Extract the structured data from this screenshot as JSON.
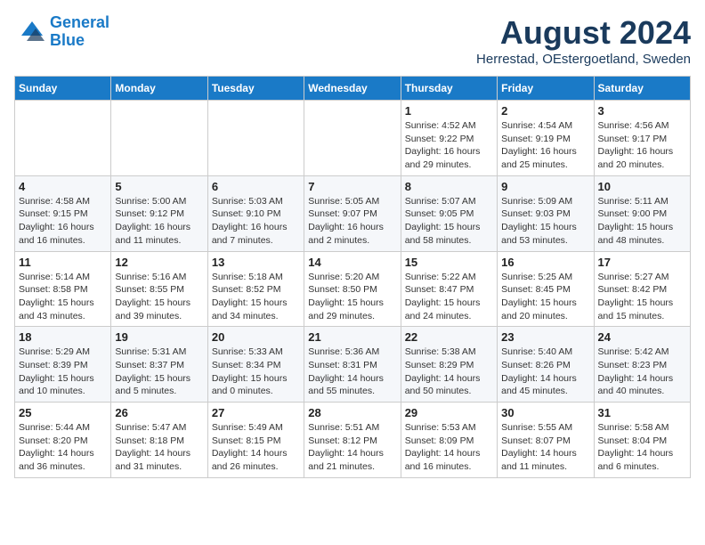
{
  "logo": {
    "line1": "General",
    "line2": "Blue"
  },
  "title": "August 2024",
  "location": "Herrestad, OEstergoetland, Sweden",
  "weekdays": [
    "Sunday",
    "Monday",
    "Tuesday",
    "Wednesday",
    "Thursday",
    "Friday",
    "Saturday"
  ],
  "weeks": [
    [
      {
        "day": "",
        "info": ""
      },
      {
        "day": "",
        "info": ""
      },
      {
        "day": "",
        "info": ""
      },
      {
        "day": "",
        "info": ""
      },
      {
        "day": "1",
        "info": "Sunrise: 4:52 AM\nSunset: 9:22 PM\nDaylight: 16 hours\nand 29 minutes."
      },
      {
        "day": "2",
        "info": "Sunrise: 4:54 AM\nSunset: 9:19 PM\nDaylight: 16 hours\nand 25 minutes."
      },
      {
        "day": "3",
        "info": "Sunrise: 4:56 AM\nSunset: 9:17 PM\nDaylight: 16 hours\nand 20 minutes."
      }
    ],
    [
      {
        "day": "4",
        "info": "Sunrise: 4:58 AM\nSunset: 9:15 PM\nDaylight: 16 hours\nand 16 minutes."
      },
      {
        "day": "5",
        "info": "Sunrise: 5:00 AM\nSunset: 9:12 PM\nDaylight: 16 hours\nand 11 minutes."
      },
      {
        "day": "6",
        "info": "Sunrise: 5:03 AM\nSunset: 9:10 PM\nDaylight: 16 hours\nand 7 minutes."
      },
      {
        "day": "7",
        "info": "Sunrise: 5:05 AM\nSunset: 9:07 PM\nDaylight: 16 hours\nand 2 minutes."
      },
      {
        "day": "8",
        "info": "Sunrise: 5:07 AM\nSunset: 9:05 PM\nDaylight: 15 hours\nand 58 minutes."
      },
      {
        "day": "9",
        "info": "Sunrise: 5:09 AM\nSunset: 9:03 PM\nDaylight: 15 hours\nand 53 minutes."
      },
      {
        "day": "10",
        "info": "Sunrise: 5:11 AM\nSunset: 9:00 PM\nDaylight: 15 hours\nand 48 minutes."
      }
    ],
    [
      {
        "day": "11",
        "info": "Sunrise: 5:14 AM\nSunset: 8:58 PM\nDaylight: 15 hours\nand 43 minutes."
      },
      {
        "day": "12",
        "info": "Sunrise: 5:16 AM\nSunset: 8:55 PM\nDaylight: 15 hours\nand 39 minutes."
      },
      {
        "day": "13",
        "info": "Sunrise: 5:18 AM\nSunset: 8:52 PM\nDaylight: 15 hours\nand 34 minutes."
      },
      {
        "day": "14",
        "info": "Sunrise: 5:20 AM\nSunset: 8:50 PM\nDaylight: 15 hours\nand 29 minutes."
      },
      {
        "day": "15",
        "info": "Sunrise: 5:22 AM\nSunset: 8:47 PM\nDaylight: 15 hours\nand 24 minutes."
      },
      {
        "day": "16",
        "info": "Sunrise: 5:25 AM\nSunset: 8:45 PM\nDaylight: 15 hours\nand 20 minutes."
      },
      {
        "day": "17",
        "info": "Sunrise: 5:27 AM\nSunset: 8:42 PM\nDaylight: 15 hours\nand 15 minutes."
      }
    ],
    [
      {
        "day": "18",
        "info": "Sunrise: 5:29 AM\nSunset: 8:39 PM\nDaylight: 15 hours\nand 10 minutes."
      },
      {
        "day": "19",
        "info": "Sunrise: 5:31 AM\nSunset: 8:37 PM\nDaylight: 15 hours\nand 5 minutes."
      },
      {
        "day": "20",
        "info": "Sunrise: 5:33 AM\nSunset: 8:34 PM\nDaylight: 15 hours\nand 0 minutes."
      },
      {
        "day": "21",
        "info": "Sunrise: 5:36 AM\nSunset: 8:31 PM\nDaylight: 14 hours\nand 55 minutes."
      },
      {
        "day": "22",
        "info": "Sunrise: 5:38 AM\nSunset: 8:29 PM\nDaylight: 14 hours\nand 50 minutes."
      },
      {
        "day": "23",
        "info": "Sunrise: 5:40 AM\nSunset: 8:26 PM\nDaylight: 14 hours\nand 45 minutes."
      },
      {
        "day": "24",
        "info": "Sunrise: 5:42 AM\nSunset: 8:23 PM\nDaylight: 14 hours\nand 40 minutes."
      }
    ],
    [
      {
        "day": "25",
        "info": "Sunrise: 5:44 AM\nSunset: 8:20 PM\nDaylight: 14 hours\nand 36 minutes."
      },
      {
        "day": "26",
        "info": "Sunrise: 5:47 AM\nSunset: 8:18 PM\nDaylight: 14 hours\nand 31 minutes."
      },
      {
        "day": "27",
        "info": "Sunrise: 5:49 AM\nSunset: 8:15 PM\nDaylight: 14 hours\nand 26 minutes."
      },
      {
        "day": "28",
        "info": "Sunrise: 5:51 AM\nSunset: 8:12 PM\nDaylight: 14 hours\nand 21 minutes."
      },
      {
        "day": "29",
        "info": "Sunrise: 5:53 AM\nSunset: 8:09 PM\nDaylight: 14 hours\nand 16 minutes."
      },
      {
        "day": "30",
        "info": "Sunrise: 5:55 AM\nSunset: 8:07 PM\nDaylight: 14 hours\nand 11 minutes."
      },
      {
        "day": "31",
        "info": "Sunrise: 5:58 AM\nSunset: 8:04 PM\nDaylight: 14 hours\nand 6 minutes."
      }
    ]
  ]
}
